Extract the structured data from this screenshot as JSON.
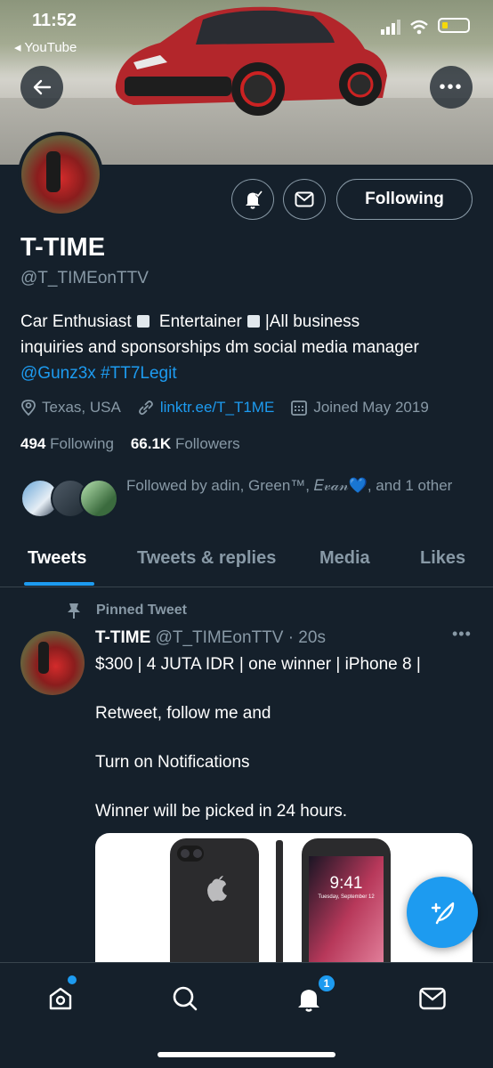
{
  "status_bar": {
    "time": "11:52",
    "back_app": "◂ YouTube"
  },
  "profile": {
    "name": "T-TIME",
    "handle": "@T_TIMEonTTV",
    "follow_button": "Following",
    "bio_line1_a": "Car Enthusiast",
    "bio_line1_b": "Entertainer",
    "bio_line1_c": "|All business",
    "bio_line2": "inquiries and sponsorships dm social media manager",
    "bio_mention": "@Gunz3x",
    "bio_hashtag": "#TT7Legit",
    "location": "Texas, USA",
    "website": "linktr.ee/T_T1ME",
    "joined": "Joined May 2019",
    "following_count": "494",
    "following_label": "Following",
    "followers_count": "66.1K",
    "followers_label": "Followers",
    "followed_by": "Followed by adin, Green™, 𝐸𝓋𝒶𝓃💙, and 1 other"
  },
  "tabs": [
    "Tweets",
    "Tweets & replies",
    "Media",
    "Likes"
  ],
  "tweet": {
    "pinned_label": "Pinned Tweet",
    "author": "T-TIME",
    "author_meta": "@T_TIMEonTTV · 20s",
    "line1": "$300 | 4 JUTA IDR | one winner | iPhone 8 |",
    "line2": "Retweet, follow me and",
    "line3": "Turn on Notifications",
    "line4": "Winner will be picked in 24 hours.",
    "media_clock": "9:41",
    "media_date": "Tuesday, September 12"
  },
  "bottom_nav": {
    "notification_badge": "1"
  },
  "colors": {
    "background": "#15202b",
    "accent": "#1d9bf0",
    "secondary_text": "#8899a6",
    "divider": "#38444d"
  },
  "icons": [
    "back-arrow-icon",
    "more-icon",
    "bell-icon",
    "mail-icon",
    "location-icon",
    "link-icon",
    "calendar-icon",
    "pin-icon",
    "compose-icon",
    "home-icon",
    "search-icon",
    "notifications-icon",
    "messages-icon"
  ]
}
